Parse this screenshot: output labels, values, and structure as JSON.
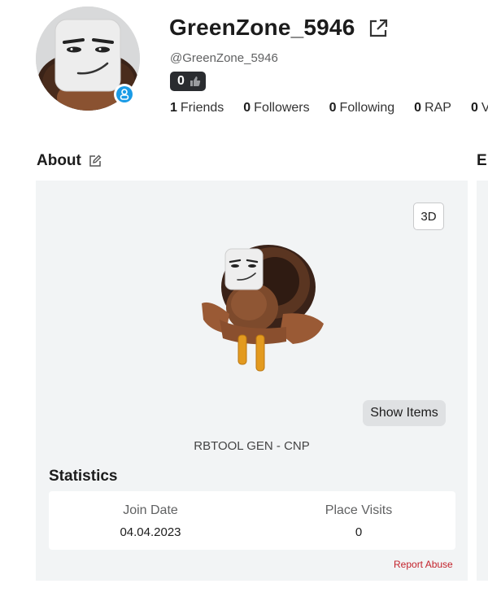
{
  "profile": {
    "username": "GreenZone_5946",
    "handle": "@GreenZone_5946",
    "badge_count": "0",
    "presence_color": "#1a9be6"
  },
  "stats_row": [
    {
      "value": "1",
      "label": "Friends"
    },
    {
      "value": "0",
      "label": "Followers"
    },
    {
      "value": "0",
      "label": "Following"
    },
    {
      "value": "0",
      "label": "RAP"
    },
    {
      "value": "0",
      "label": "V"
    }
  ],
  "about": {
    "title": "About",
    "right_heading_partial": "E",
    "button_3d": "3D",
    "show_items": "Show Items",
    "outfit_name": "RBTOOL GEN - CNP"
  },
  "statistics": {
    "title": "Statistics",
    "join_date_label": "Join Date",
    "join_date_value": "04.04.2023",
    "place_visits_label": "Place Visits",
    "place_visits_value": "0"
  },
  "report_abuse": "Report Abuse",
  "colors": {
    "report": "#c3222b",
    "panel_bg": "#f2f4f5",
    "badge_bg": "#2a2c30"
  }
}
